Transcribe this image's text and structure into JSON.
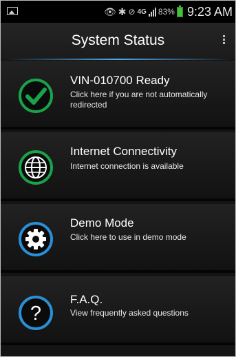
{
  "status_bar": {
    "battery_pct": "83%",
    "time": "9:23 AM",
    "network": "4G"
  },
  "header": {
    "title": "System Status"
  },
  "items": [
    {
      "title": "VIN-010700 Ready",
      "subtitle": "Click here if you are not automatically redirected",
      "icon": "check-circle-icon",
      "color": "#19a34a"
    },
    {
      "title": "Internet Connectivity",
      "subtitle": "Internet connection is available",
      "icon": "globe-icon",
      "color": "#19a34a"
    },
    {
      "title": "Demo Mode",
      "subtitle": "Click here to use in demo mode",
      "icon": "gear-icon",
      "color": "#2a8fd6"
    },
    {
      "title": "F.A.Q.",
      "subtitle": "View frequently asked questions",
      "icon": "question-icon",
      "color": "#2a8fd6"
    }
  ]
}
